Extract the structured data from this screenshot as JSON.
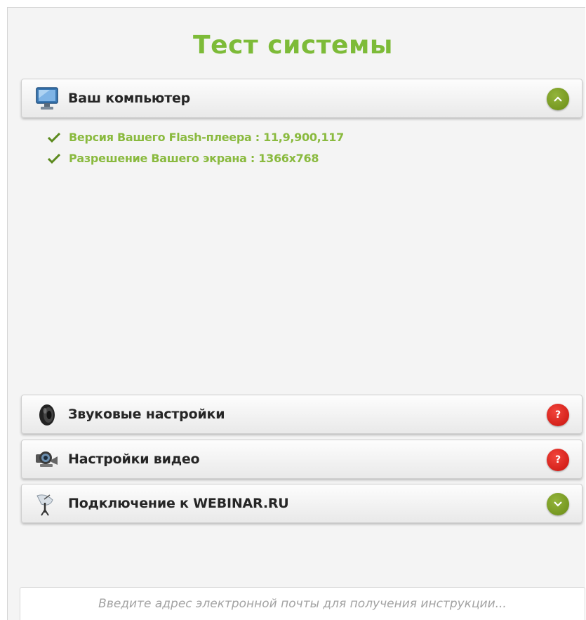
{
  "page": {
    "title": "Тест системы"
  },
  "sections": [
    {
      "label": "Ваш компьютер",
      "icon": "monitor-icon",
      "state": "expanded",
      "button_icon": "chevron-up-icon"
    },
    {
      "label": "Звуковые настройки",
      "icon": "speaker-icon",
      "state": "error",
      "button_text": "?"
    },
    {
      "label": "Настройки видео",
      "icon": "webcam-icon",
      "state": "error",
      "button_text": "?"
    },
    {
      "label": "Подключение к WEBINAR.RU",
      "icon": "satellite-dish-icon",
      "state": "collapsed",
      "button_icon": "chevron-down-icon"
    }
  ],
  "computer_info": [
    {
      "text": "Версия Вашего Flash-плеера : 11,9,900,117",
      "icon": "checkmark-icon"
    },
    {
      "text": "Разрешение Вашего экрана : 1366x768",
      "icon": "checkmark-icon"
    }
  ],
  "email": {
    "placeholder": "Введите адрес электронной почты для получения инструкции..."
  },
  "colors": {
    "accent_green": "#7dbb38",
    "ok_button": "#7a9c1f",
    "error_button": "#d9211b"
  }
}
